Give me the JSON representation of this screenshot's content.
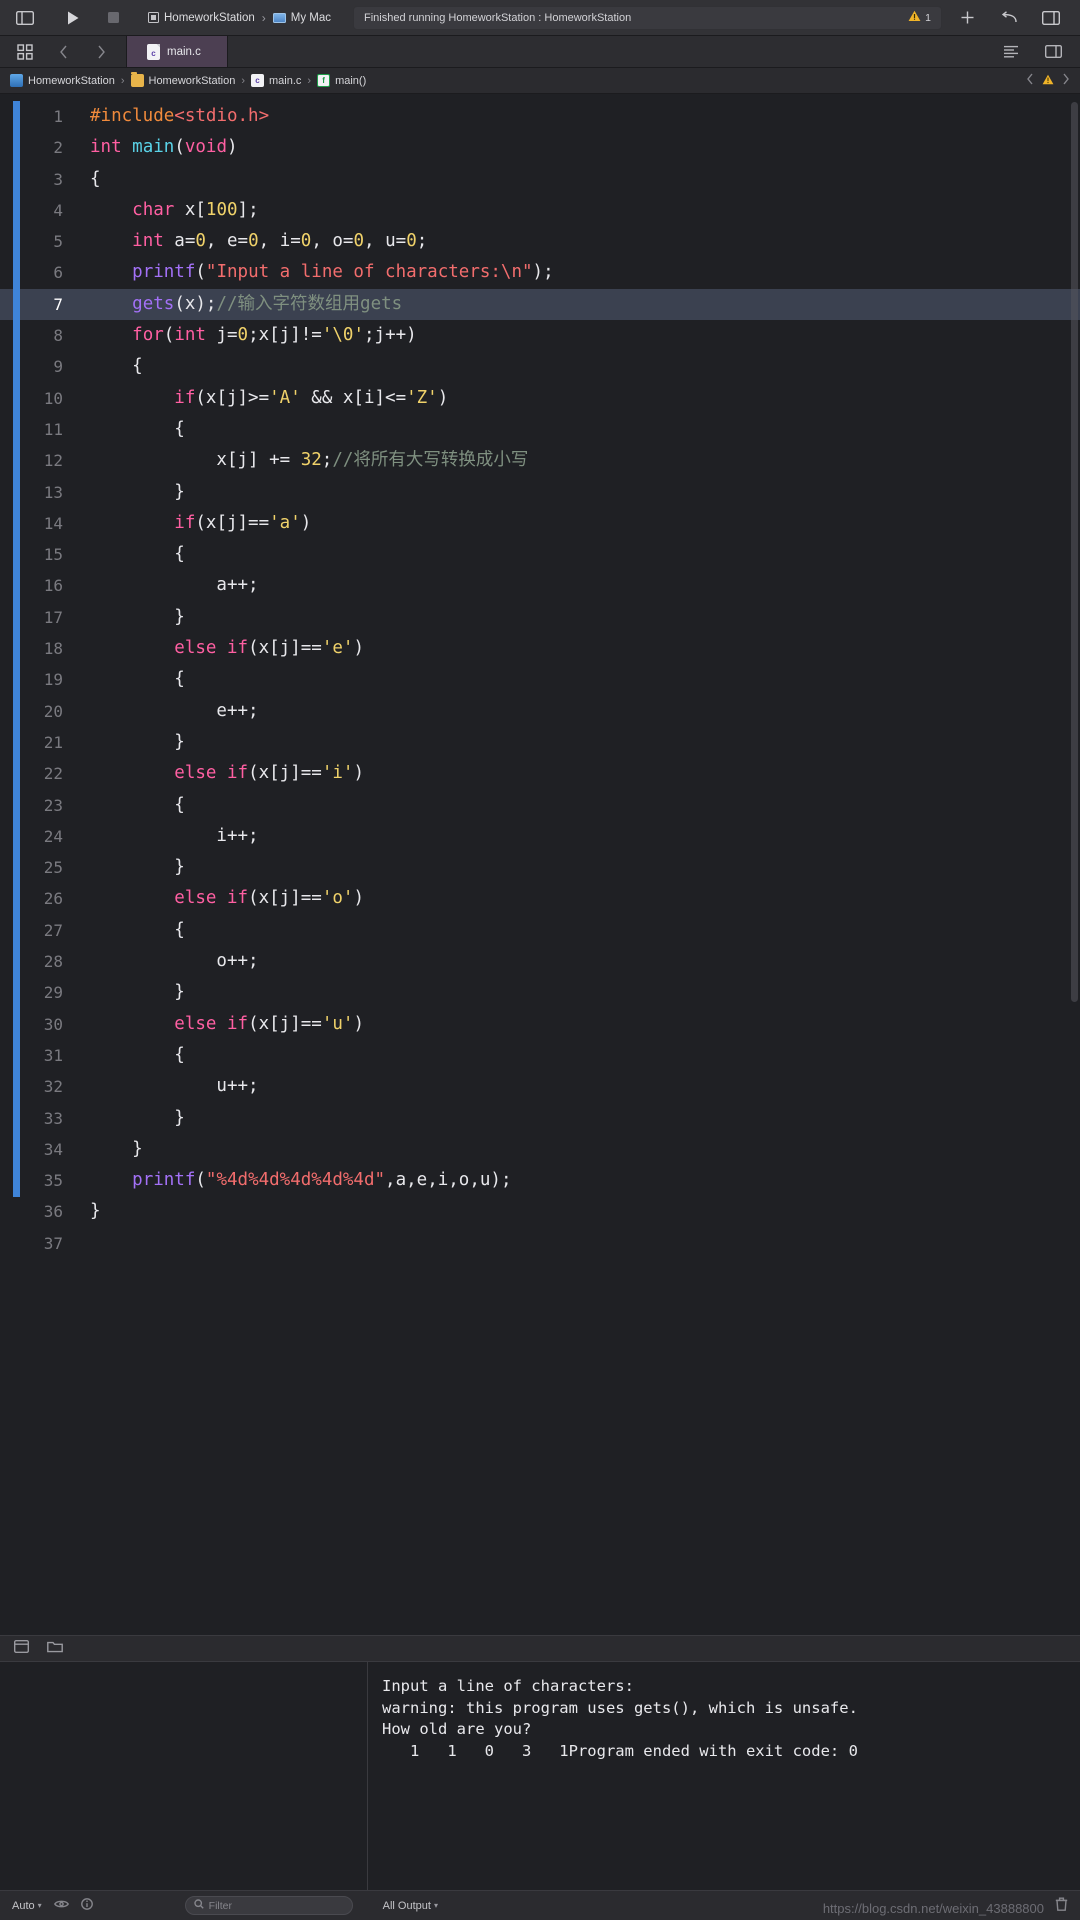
{
  "toolbar": {
    "sidebar_icon": "sidebar-toggle-icon",
    "run_icon": "run-play-icon",
    "stop_icon": "stop-square-icon",
    "scheme_target": "HomeworkStation",
    "scheme_separator": "›",
    "scheme_destination": "My Mac",
    "status_message": "Finished running HomeworkStation : HomeworkStation",
    "warning_count": "1",
    "warning_icon": "warning-triangle-icon",
    "add_icon": "plus-icon",
    "undo_icon": "undo-arrow-icon",
    "inspector_icon": "inspector-panel-icon",
    "accent_color": "#3f84d8",
    "warning_color": "#f0b429"
  },
  "tabbar": {
    "grid_icon": "tab-grid-icon",
    "back_icon": "chevron-left-icon",
    "forward_icon": "chevron-right-icon",
    "tab_label": "main.c",
    "tab_file_icon": "c-file-icon",
    "tab_badge": "c",
    "list_icon": "list-lines-icon",
    "split_icon": "split-editor-icon"
  },
  "breadcrumb": {
    "items": [
      {
        "label": "HomeworkStation",
        "icon": "project-icon"
      },
      {
        "label": "HomeworkStation",
        "icon": "folder-icon"
      },
      {
        "label": "main.c",
        "icon": "c-file-icon"
      },
      {
        "label": "main()",
        "icon": "function-icon"
      }
    ],
    "separator": "›",
    "prev_icon": "chevron-left-icon",
    "warning_icon": "warning-triangle-icon",
    "next_icon": "chevron-right-icon"
  },
  "editor": {
    "highlighted_line": 7,
    "total_lines": 37,
    "lines": [
      {
        "n": 1,
        "tokens": [
          {
            "t": "#include",
            "c": "t-pre"
          },
          {
            "t": "<stdio.h>",
            "c": "t-hdr"
          }
        ]
      },
      {
        "n": 2,
        "tokens": [
          {
            "t": "int ",
            "c": "t-kw"
          },
          {
            "t": "main",
            "c": "t-fnd"
          },
          {
            "t": "(",
            "c": "t-pln"
          },
          {
            "t": "void",
            "c": "t-kw"
          },
          {
            "t": ")",
            "c": "t-pln"
          }
        ]
      },
      {
        "n": 3,
        "tokens": [
          {
            "t": "{",
            "c": "t-pln"
          }
        ]
      },
      {
        "n": 4,
        "tokens": [
          {
            "t": "    ",
            "c": "t-pln"
          },
          {
            "t": "char",
            "c": "t-kw"
          },
          {
            "t": " x[",
            "c": "t-pln"
          },
          {
            "t": "100",
            "c": "t-num"
          },
          {
            "t": "];",
            "c": "t-pln"
          }
        ]
      },
      {
        "n": 5,
        "tokens": [
          {
            "t": "    ",
            "c": "t-pln"
          },
          {
            "t": "int",
            "c": "t-kw"
          },
          {
            "t": " a=",
            "c": "t-pln"
          },
          {
            "t": "0",
            "c": "t-num"
          },
          {
            "t": ", e=",
            "c": "t-pln"
          },
          {
            "t": "0",
            "c": "t-num"
          },
          {
            "t": ", i=",
            "c": "t-pln"
          },
          {
            "t": "0",
            "c": "t-num"
          },
          {
            "t": ", o=",
            "c": "t-pln"
          },
          {
            "t": "0",
            "c": "t-num"
          },
          {
            "t": ", u=",
            "c": "t-pln"
          },
          {
            "t": "0",
            "c": "t-num"
          },
          {
            "t": ";",
            "c": "t-pln"
          }
        ]
      },
      {
        "n": 6,
        "tokens": [
          {
            "t": "    ",
            "c": "t-pln"
          },
          {
            "t": "printf",
            "c": "t-fn"
          },
          {
            "t": "(",
            "c": "t-pln"
          },
          {
            "t": "\"Input a line of characters:\\n\"",
            "c": "t-str"
          },
          {
            "t": ");",
            "c": "t-pln"
          }
        ]
      },
      {
        "n": 7,
        "tokens": [
          {
            "t": "    ",
            "c": "t-pln"
          },
          {
            "t": "gets",
            "c": "t-fn"
          },
          {
            "t": "(x);",
            "c": "t-pln"
          },
          {
            "t": "//输入字符数组用gets",
            "c": "t-cmt"
          }
        ]
      },
      {
        "n": 8,
        "tokens": [
          {
            "t": "    ",
            "c": "t-pln"
          },
          {
            "t": "for",
            "c": "t-kw"
          },
          {
            "t": "(",
            "c": "t-pln"
          },
          {
            "t": "int",
            "c": "t-kw"
          },
          {
            "t": " j=",
            "c": "t-pln"
          },
          {
            "t": "0",
            "c": "t-num"
          },
          {
            "t": ";x[j]!=",
            "c": "t-pln"
          },
          {
            "t": "'\\0'",
            "c": "t-num"
          },
          {
            "t": ";j++)",
            "c": "t-pln"
          }
        ]
      },
      {
        "n": 9,
        "tokens": [
          {
            "t": "    {",
            "c": "t-pln"
          }
        ]
      },
      {
        "n": 10,
        "tokens": [
          {
            "t": "        ",
            "c": "t-pln"
          },
          {
            "t": "if",
            "c": "t-kw"
          },
          {
            "t": "(x[j]>=",
            "c": "t-pln"
          },
          {
            "t": "'A'",
            "c": "t-num"
          },
          {
            "t": " && x[i]<=",
            "c": "t-pln"
          },
          {
            "t": "'Z'",
            "c": "t-num"
          },
          {
            "t": ")",
            "c": "t-pln"
          }
        ]
      },
      {
        "n": 11,
        "tokens": [
          {
            "t": "        {",
            "c": "t-pln"
          }
        ]
      },
      {
        "n": 12,
        "tokens": [
          {
            "t": "            x[j] += ",
            "c": "t-pln"
          },
          {
            "t": "32",
            "c": "t-num"
          },
          {
            "t": ";",
            "c": "t-pln"
          },
          {
            "t": "//将所有大写转换成小写",
            "c": "t-cmt"
          }
        ]
      },
      {
        "n": 13,
        "tokens": [
          {
            "t": "        }",
            "c": "t-pln"
          }
        ]
      },
      {
        "n": 14,
        "tokens": [
          {
            "t": "        ",
            "c": "t-pln"
          },
          {
            "t": "if",
            "c": "t-kw"
          },
          {
            "t": "(x[j]==",
            "c": "t-pln"
          },
          {
            "t": "'a'",
            "c": "t-num"
          },
          {
            "t": ")",
            "c": "t-pln"
          }
        ]
      },
      {
        "n": 15,
        "tokens": [
          {
            "t": "        {",
            "c": "t-pln"
          }
        ]
      },
      {
        "n": 16,
        "tokens": [
          {
            "t": "            a++;",
            "c": "t-pln"
          }
        ]
      },
      {
        "n": 17,
        "tokens": [
          {
            "t": "        }",
            "c": "t-pln"
          }
        ]
      },
      {
        "n": 18,
        "tokens": [
          {
            "t": "        ",
            "c": "t-pln"
          },
          {
            "t": "else if",
            "c": "t-kw"
          },
          {
            "t": "(x[j]==",
            "c": "t-pln"
          },
          {
            "t": "'e'",
            "c": "t-num"
          },
          {
            "t": ")",
            "c": "t-pln"
          }
        ]
      },
      {
        "n": 19,
        "tokens": [
          {
            "t": "        {",
            "c": "t-pln"
          }
        ]
      },
      {
        "n": 20,
        "tokens": [
          {
            "t": "            e++;",
            "c": "t-pln"
          }
        ]
      },
      {
        "n": 21,
        "tokens": [
          {
            "t": "        }",
            "c": "t-pln"
          }
        ]
      },
      {
        "n": 22,
        "tokens": [
          {
            "t": "        ",
            "c": "t-pln"
          },
          {
            "t": "else if",
            "c": "t-kw"
          },
          {
            "t": "(x[j]==",
            "c": "t-pln"
          },
          {
            "t": "'i'",
            "c": "t-num"
          },
          {
            "t": ")",
            "c": "t-pln"
          }
        ]
      },
      {
        "n": 23,
        "tokens": [
          {
            "t": "        {",
            "c": "t-pln"
          }
        ]
      },
      {
        "n": 24,
        "tokens": [
          {
            "t": "            i++;",
            "c": "t-pln"
          }
        ]
      },
      {
        "n": 25,
        "tokens": [
          {
            "t": "        }",
            "c": "t-pln"
          }
        ]
      },
      {
        "n": 26,
        "tokens": [
          {
            "t": "        ",
            "c": "t-pln"
          },
          {
            "t": "else if",
            "c": "t-kw"
          },
          {
            "t": "(x[j]==",
            "c": "t-pln"
          },
          {
            "t": "'o'",
            "c": "t-num"
          },
          {
            "t": ")",
            "c": "t-pln"
          }
        ]
      },
      {
        "n": 27,
        "tokens": [
          {
            "t": "        {",
            "c": "t-pln"
          }
        ]
      },
      {
        "n": 28,
        "tokens": [
          {
            "t": "            o++;",
            "c": "t-pln"
          }
        ]
      },
      {
        "n": 29,
        "tokens": [
          {
            "t": "        }",
            "c": "t-pln"
          }
        ]
      },
      {
        "n": 30,
        "tokens": [
          {
            "t": "        ",
            "c": "t-pln"
          },
          {
            "t": "else if",
            "c": "t-kw"
          },
          {
            "t": "(x[j]==",
            "c": "t-pln"
          },
          {
            "t": "'u'",
            "c": "t-num"
          },
          {
            "t": ")",
            "c": "t-pln"
          }
        ]
      },
      {
        "n": 31,
        "tokens": [
          {
            "t": "        {",
            "c": "t-pln"
          }
        ]
      },
      {
        "n": 32,
        "tokens": [
          {
            "t": "            u++;",
            "c": "t-pln"
          }
        ]
      },
      {
        "n": 33,
        "tokens": [
          {
            "t": "        }",
            "c": "t-pln"
          }
        ]
      },
      {
        "n": 34,
        "tokens": [
          {
            "t": "    }",
            "c": "t-pln"
          }
        ]
      },
      {
        "n": 35,
        "tokens": [
          {
            "t": "    ",
            "c": "t-pln"
          },
          {
            "t": "printf",
            "c": "t-fn"
          },
          {
            "t": "(",
            "c": "t-pln"
          },
          {
            "t": "\"%4d%4d%4d%4d%4d\"",
            "c": "t-str"
          },
          {
            "t": ",a,e,i,o,u);",
            "c": "t-pln"
          }
        ]
      },
      {
        "n": 36,
        "tokens": [
          {
            "t": "}",
            "c": "t-pln"
          }
        ]
      },
      {
        "n": 37,
        "tokens": [
          {
            "t": "",
            "c": "t-pln"
          }
        ]
      }
    ]
  },
  "console": {
    "variables_icon": "variables-view-icon",
    "console_icon": "console-view-icon",
    "output_lines": [
      "Input a line of characters:",
      "warning: this program uses gets(), which is unsafe.",
      "How old are you?",
      "   1   1   0   3   1Program ended with exit code: 0"
    ],
    "footer": {
      "auto_label": "Auto",
      "auto_chevron": "⌃",
      "eye_icon": "eye-icon",
      "info_icon": "info-circle-icon",
      "filter_placeholder": "Filter",
      "filter_icon": "filter-search-icon",
      "filter_value": "",
      "all_output_label": "All Output",
      "all_output_chevron": "⌃",
      "trash_icon": "trash-icon"
    }
  },
  "watermark": {
    "text": "https://blog.csdn.net/weixin_43888800"
  }
}
